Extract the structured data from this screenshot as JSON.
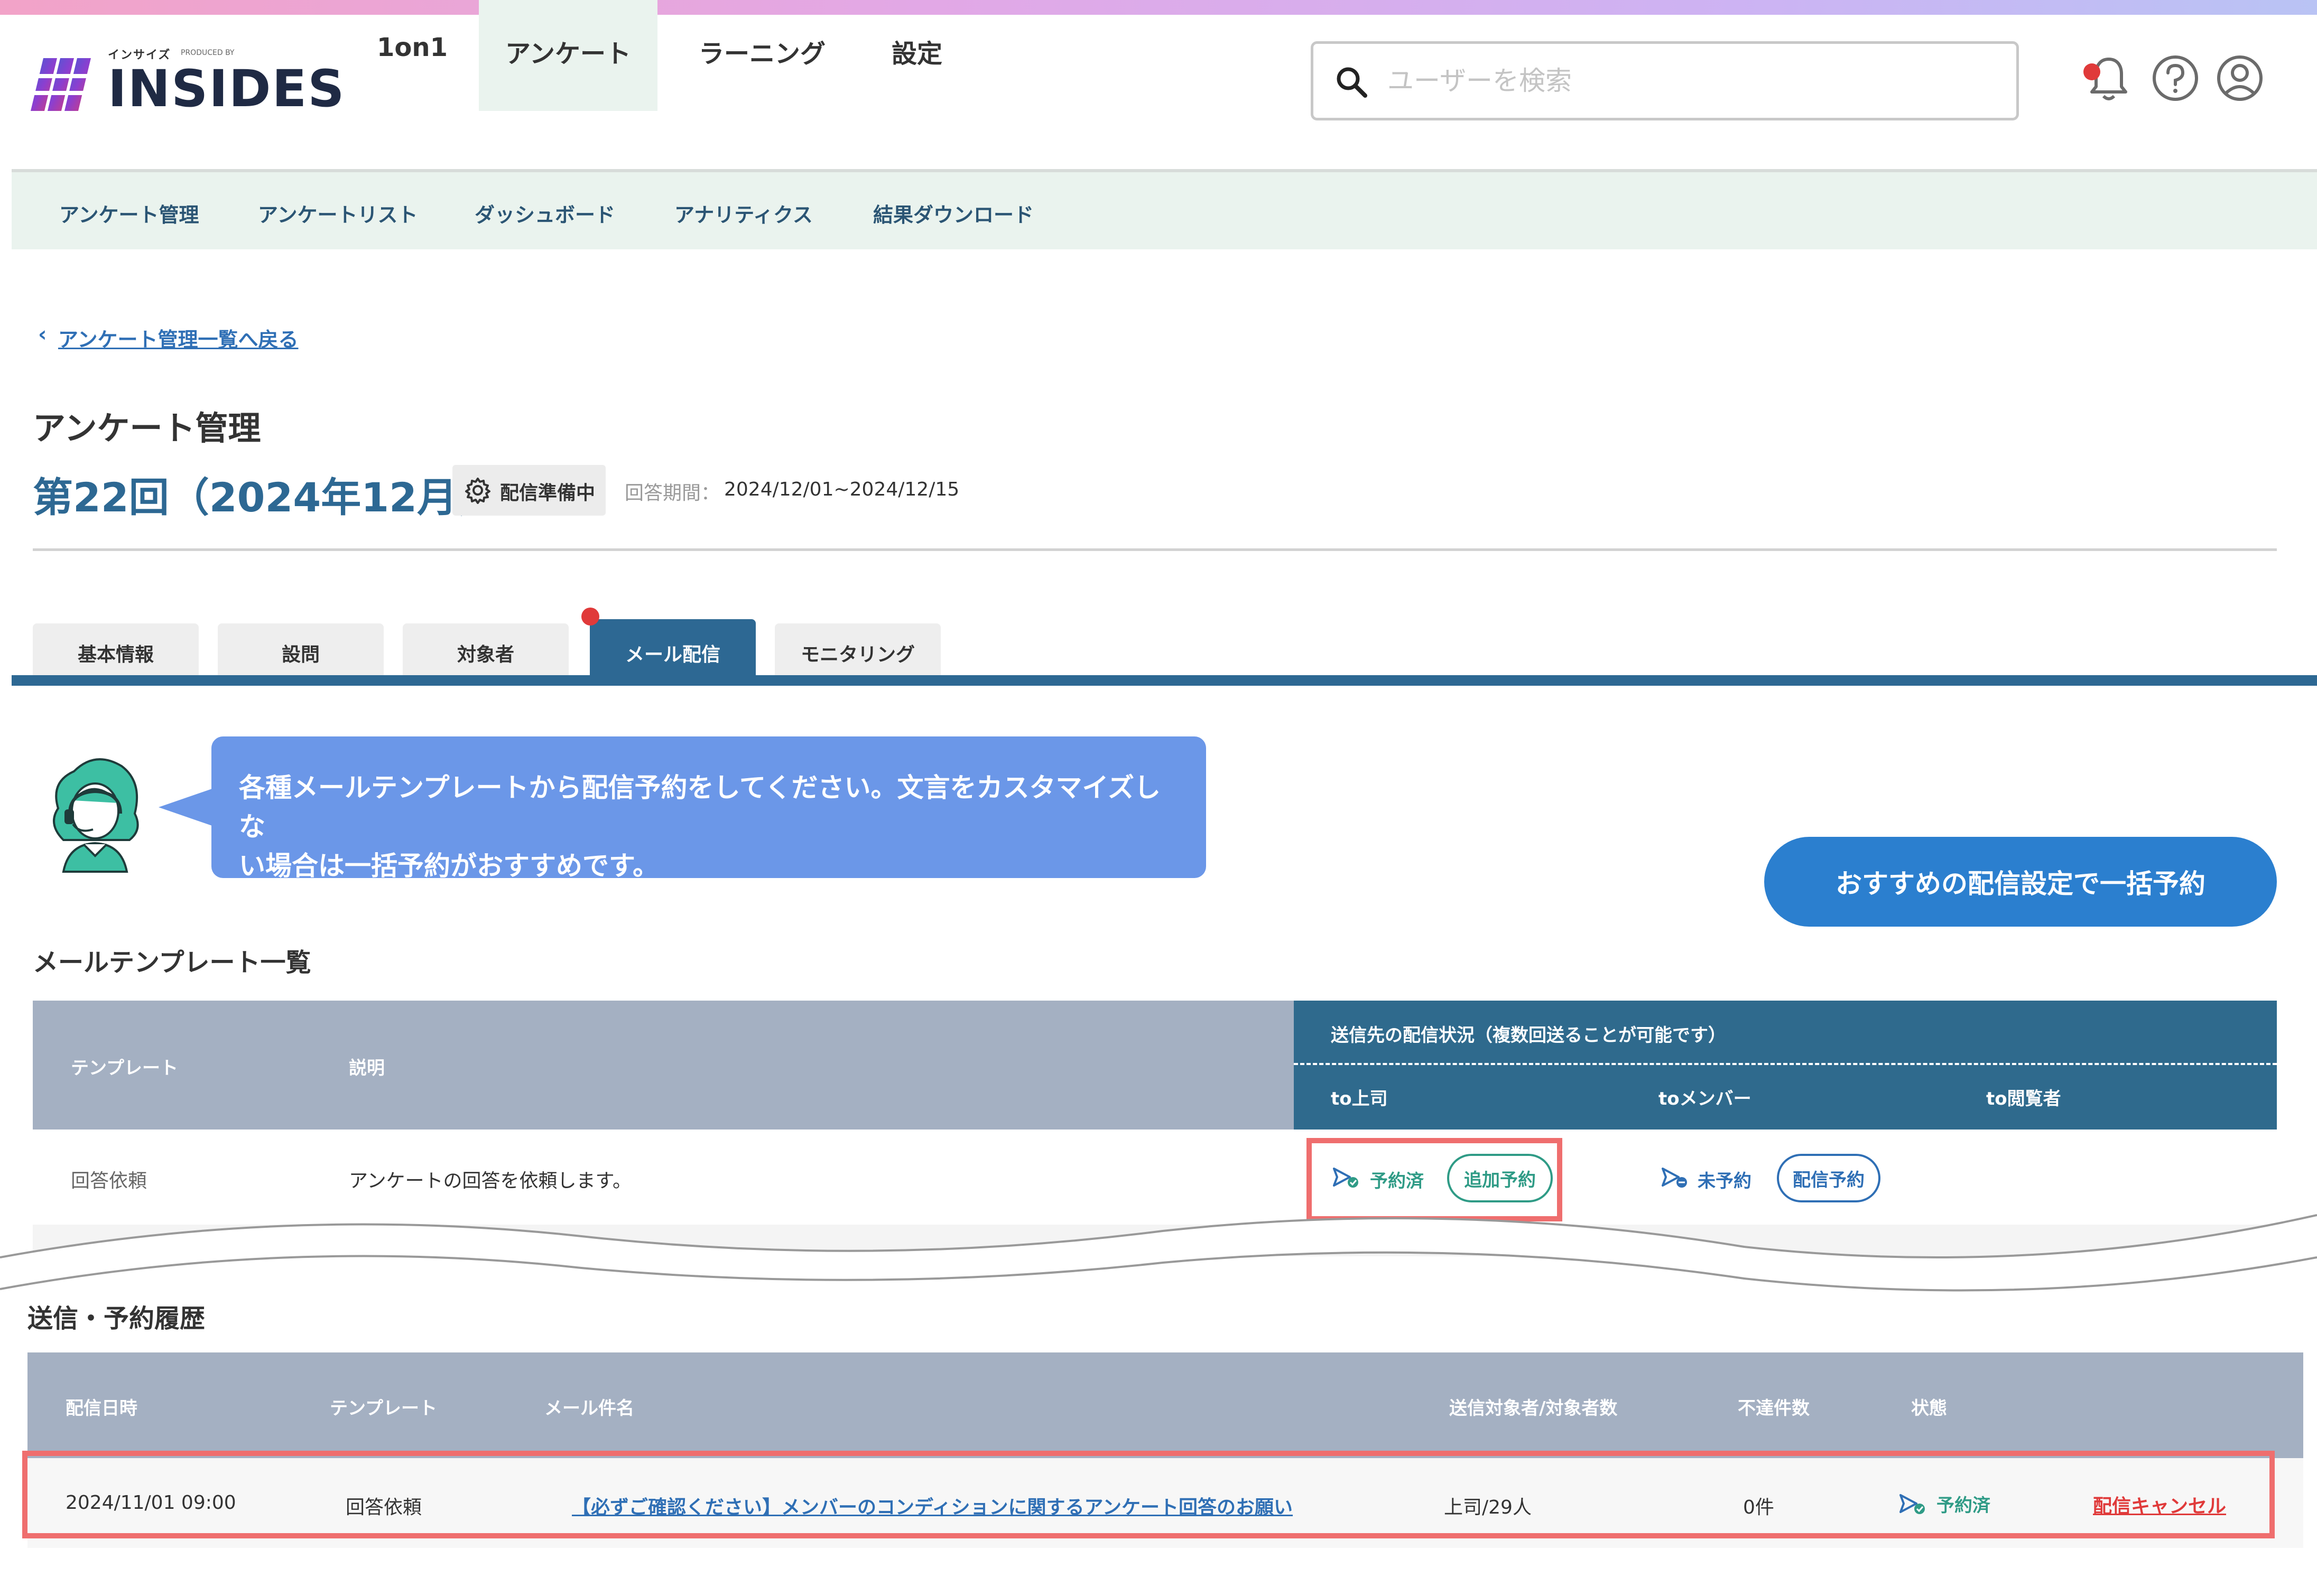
{
  "brand": {
    "name": "INSIDES",
    "kana": "インサイズ",
    "produced_by": "PRODUCED BY"
  },
  "nav": {
    "items": [
      {
        "label": "1on1",
        "active": false
      },
      {
        "label": "アンケート",
        "active": true
      },
      {
        "label": "ラーニング",
        "active": false
      },
      {
        "label": "設定",
        "active": false
      }
    ]
  },
  "search": {
    "placeholder": "ユーザーを検索",
    "value": ""
  },
  "header_icons": [
    "bell-icon",
    "help-icon",
    "user-icon"
  ],
  "subnav": {
    "items": [
      "アンケート管理",
      "アンケートリスト",
      "ダッシュボード",
      "アナリティクス",
      "結果ダウンロード"
    ]
  },
  "breadcrumb": {
    "back_label": "アンケート管理一覧へ戻る"
  },
  "page": {
    "title": "アンケート管理",
    "survey_title": "第22回（2024年12月）",
    "status": "配信準備中",
    "period_label": "回答期間：",
    "period_value": "2024/12/01~2024/12/15"
  },
  "tabs": [
    {
      "label": "基本情報",
      "active": false
    },
    {
      "label": "設問",
      "active": false
    },
    {
      "label": "対象者",
      "active": false
    },
    {
      "label": "メール配信",
      "active": true
    },
    {
      "label": "モニタリング",
      "active": false
    }
  ],
  "guide": {
    "message": "各種メールテンプレートから配信予約をしてください。文言をカスタマイズしない場合は一括予約がおすすめです。",
    "line1": "各種メールテンプレートから配信予約をしてください。文言をカスタマイズしな",
    "line2": "い場合は一括予約がおすすめです。"
  },
  "bulk_button": "おすすめの配信設定で一括予約",
  "templates": {
    "section_title": "メールテンプレート一覧",
    "headers": {
      "template": "テンプレート",
      "description": "説明",
      "status_group": "送信先の配信状況（複数回送ることが可能です）",
      "to_boss": "to上司",
      "to_member": "toメンバー",
      "to_viewer": "to閲覧者"
    },
    "rows": [
      {
        "template": "回答依頼",
        "description": "アンケートの回答を依頼します。",
        "boss_status": "予約済",
        "boss_action": "追加予約",
        "member_status": "未予約",
        "member_action": "配信予約"
      }
    ]
  },
  "history": {
    "section_title": "送信・予約履歴",
    "headers": {
      "datetime": "配信日時",
      "template": "テンプレート",
      "subject": "メール件名",
      "recipients": "送信対象者/対象者数",
      "undelivered": "不達件数",
      "state": "状態"
    },
    "rows": [
      {
        "datetime": "2024/11/01 09:00",
        "template": "回答依頼",
        "subject": "【必ずご確認ください】メンバーのコンディションに関するアンケート回答のお願い",
        "recipients": "上司/29人",
        "undelivered": "0件",
        "state": "予約済",
        "cancel": "配信キャンセル"
      }
    ]
  },
  "colors": {
    "primary": "#2d6893",
    "accent_blue": "#2b7fcf",
    "bubble": "#6b97e8",
    "status_green": "#2f9b86",
    "highlight": "#ef6e6e",
    "cancel_red": "#e03a3a",
    "subnav_bg": "#eaf3ee",
    "table_head_gray": "#a4b0c2"
  }
}
